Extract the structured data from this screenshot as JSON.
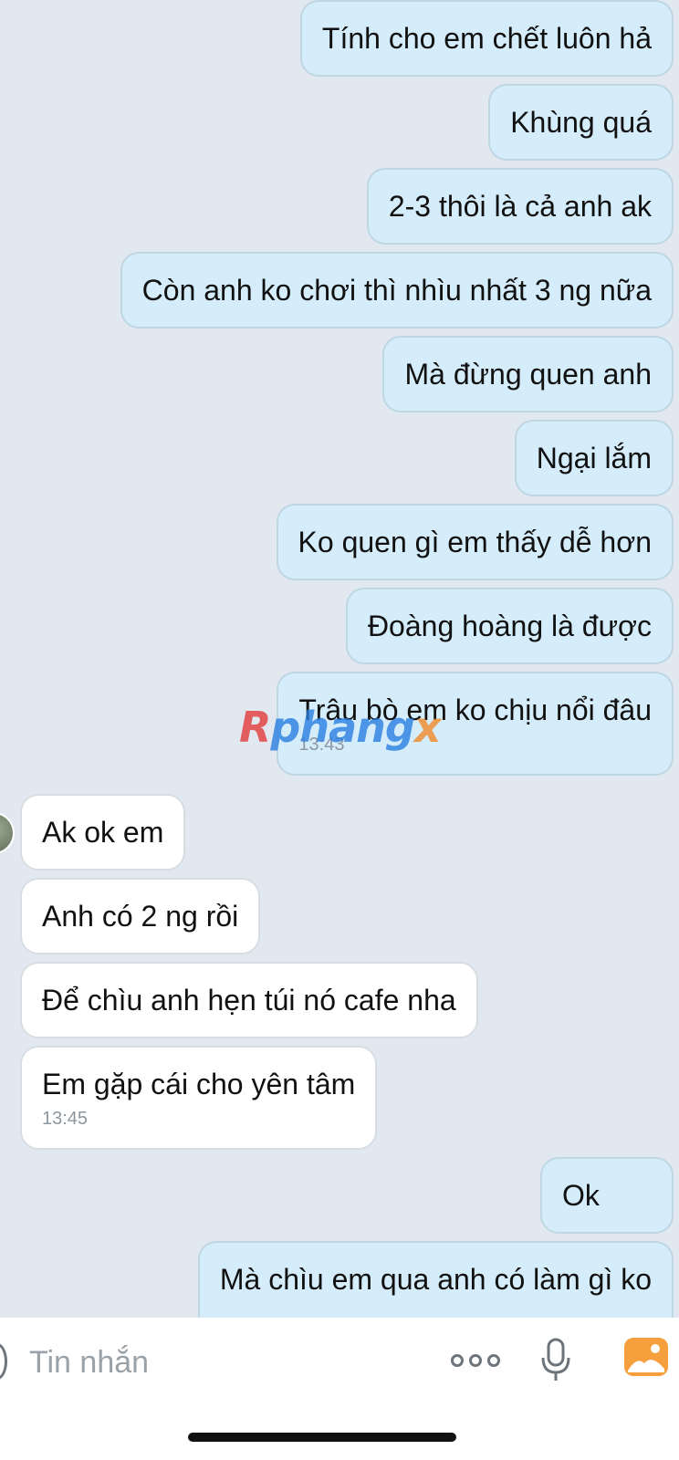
{
  "messages": [
    {
      "dir": "out",
      "text": "Tính cho em chết luôn hả"
    },
    {
      "dir": "out",
      "text": "Khùng quá"
    },
    {
      "dir": "out",
      "text": "2-3 thôi là cả anh ak"
    },
    {
      "dir": "out",
      "text": "Còn anh ko chơi thì nhìu nhất 3 ng nữa"
    },
    {
      "dir": "out",
      "text": "Mà đừng quen anh"
    },
    {
      "dir": "out",
      "text": "Ngại lắm"
    },
    {
      "dir": "out",
      "text": "Ko quen gì em thấy dễ hơn"
    },
    {
      "dir": "out",
      "text": "Đoàng hoàng là được"
    },
    {
      "dir": "out",
      "text": "Trâu bò em ko chịu nổi đâu",
      "time": "13:43"
    },
    {
      "dir": "in",
      "text": "Ak ok em"
    },
    {
      "dir": "in",
      "text": "Anh có 2 ng rồi"
    },
    {
      "dir": "in",
      "text": "Để chìu anh hẹn túi nó cafe nha"
    },
    {
      "dir": "in",
      "text": "Em gặp cái cho yên tâm",
      "time": "13:45"
    },
    {
      "dir": "out",
      "text": "Ok"
    },
    {
      "dir": "out",
      "text": "Mà chìu em qua anh có làm gì ko"
    }
  ],
  "watermark": {
    "part1": "R",
    "part2": "phang",
    "part3": "x"
  },
  "input": {
    "placeholder": "Tin nhắn",
    "value": ""
  },
  "icons": {
    "emoji": "emoji-icon",
    "more": "more-options-icon",
    "mic": "microphone-icon",
    "photo": "photo-gallery-icon"
  },
  "colors": {
    "chat_background": "#e2e8ef",
    "outgoing_bubble": "#d5edfb",
    "incoming_bubble": "#ffffff",
    "photo_icon": "#f5a03c"
  }
}
